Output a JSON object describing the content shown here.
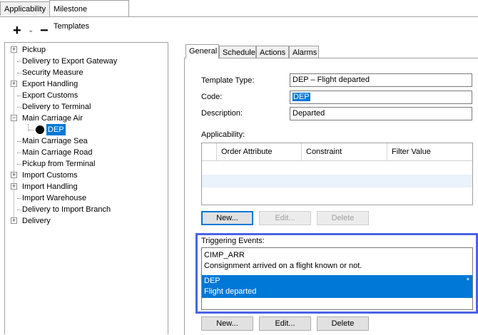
{
  "top_tabs": [
    {
      "label": "Applicability",
      "active": false
    },
    {
      "label": "Milestone Templates",
      "active": true
    }
  ],
  "toolbar": {
    "add": "+",
    "dropdown": "⌄",
    "remove": "−"
  },
  "tree": {
    "items": [
      {
        "label": "Pickup",
        "expandable": true,
        "expanded": false
      },
      {
        "label": "Delivery to Export Gateway",
        "expandable": false
      },
      {
        "label": "Security Measure",
        "expandable": false
      },
      {
        "label": "Export Handling",
        "expandable": true,
        "expanded": false
      },
      {
        "label": "Export Customs",
        "expandable": false
      },
      {
        "label": "Delivery to Terminal",
        "expandable": false
      },
      {
        "label": "Main Carriage Air",
        "expandable": true,
        "expanded": true
      },
      {
        "label": "DEP",
        "child": true,
        "selected": true
      },
      {
        "label": "Main Carriage Sea",
        "expandable": false
      },
      {
        "label": "Main Carriage Road",
        "expandable": false
      },
      {
        "label": "Pickup from Terminal",
        "expandable": false
      },
      {
        "label": "Import Customs",
        "expandable": true,
        "expanded": false
      },
      {
        "label": "Import Handling",
        "expandable": true,
        "expanded": false
      },
      {
        "label": "Import Warehouse",
        "expandable": false
      },
      {
        "label": "Delivery to Import Branch",
        "expandable": false
      },
      {
        "label": "Delivery",
        "expandable": true,
        "expanded": false
      }
    ]
  },
  "sub_tabs": [
    {
      "label": "General",
      "active": true
    },
    {
      "label": "Schedule",
      "active": false
    },
    {
      "label": "Actions",
      "active": false
    },
    {
      "label": "Alarms",
      "active": false
    }
  ],
  "form": {
    "template_type_label": "Template Type:",
    "template_type_value": "DEP – Flight departed",
    "code_label": "Code:",
    "code_value": "DEP",
    "description_label": "Description:",
    "description_value": "Departed"
  },
  "applicability": {
    "label": "Applicability:",
    "columns": [
      "Order Attribute",
      "Constraint",
      "Filter Value"
    ],
    "rows": [],
    "buttons": {
      "new": "New...",
      "edit": "Edit...",
      "delete": "Delete"
    }
  },
  "triggering_events": {
    "label": "Triggering Events:",
    "items": [
      {
        "code": "CIMP_ARR",
        "description": "Consignment arrived on a flight known or not.",
        "selected": false
      },
      {
        "code": "DEP",
        "description": "Flight departed",
        "selected": true,
        "marker": "*"
      }
    ],
    "buttons": {
      "new": "New...",
      "edit": "Edit...",
      "delete": "Delete"
    }
  },
  "colors": {
    "selection": "#0078d7",
    "highlight_border": "#4a63e8"
  }
}
